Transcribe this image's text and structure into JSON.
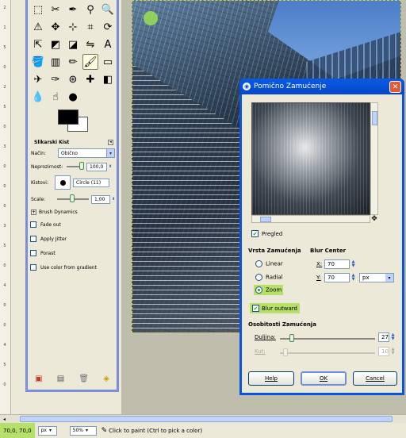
{
  "ruler": {
    "ticks": [
      "2",
      "1",
      "5",
      "0",
      "2",
      "5",
      "0",
      "3",
      "0",
      "0",
      "0",
      "3",
      "5",
      "0",
      "4",
      "0",
      "0",
      "4",
      "5",
      "0"
    ]
  },
  "toolbox": {
    "tools": [
      {
        "icon": "rect-select-icon",
        "glyph": "⬚"
      },
      {
        "icon": "fuzzy-select-icon",
        "glyph": "✂"
      },
      {
        "icon": "paths-icon",
        "glyph": "✒"
      },
      {
        "icon": "color-picker-icon",
        "glyph": "⚲"
      },
      {
        "icon": "zoom-icon",
        "glyph": "🔍"
      },
      {
        "icon": "measure-icon",
        "glyph": "⚠"
      },
      {
        "icon": "move-icon",
        "glyph": "✥"
      },
      {
        "icon": "align-icon",
        "glyph": "⊹"
      },
      {
        "icon": "crop-icon",
        "glyph": "⌗"
      },
      {
        "icon": "rotate-icon",
        "glyph": "⟳"
      },
      {
        "icon": "scale-icon",
        "glyph": "⇱"
      },
      {
        "icon": "shear-icon",
        "glyph": "◩"
      },
      {
        "icon": "perspective-icon",
        "glyph": "◪"
      },
      {
        "icon": "flip-icon",
        "glyph": "⇋"
      },
      {
        "icon": "text-icon",
        "glyph": "A"
      },
      {
        "icon": "bucket-fill-icon",
        "glyph": "🪣"
      },
      {
        "icon": "blend-icon",
        "glyph": "▥"
      },
      {
        "icon": "pencil-icon",
        "glyph": "✏"
      },
      {
        "icon": "paintbrush-icon",
        "glyph": "🖌"
      },
      {
        "icon": "eraser-icon",
        "glyph": "▭"
      },
      {
        "icon": "airbrush-icon",
        "glyph": "✈"
      },
      {
        "icon": "ink-icon",
        "glyph": "✑"
      },
      {
        "icon": "clone-icon",
        "glyph": "⊛"
      },
      {
        "icon": "heal-icon",
        "glyph": "✚"
      },
      {
        "icon": "perspective-clone-icon",
        "glyph": "◧"
      },
      {
        "icon": "blur-icon",
        "glyph": "💧"
      },
      {
        "icon": "smudge-icon",
        "glyph": "☝"
      },
      {
        "icon": "dodge-burn-icon",
        "glyph": "●"
      }
    ],
    "options": {
      "title": "Slikarski Kist",
      "mode_label": "Način:",
      "mode_value": "Obično",
      "opacity_label": "Neprozirnost:",
      "opacity_value": "100,0",
      "opacity_fraction": 1.0,
      "brush_label": "Kistovi:",
      "brush_value": "Circle (11)",
      "scale_label": "Scale:",
      "scale_value": "1,00",
      "dynamics_label": "Brush Dynamics",
      "fade_out": "Fade out",
      "apply_jitter": "Apply Jitter",
      "porast": "Porast",
      "use_gradient": "Use color from gradient"
    },
    "footer_icons": [
      "save-icon",
      "restore-icon",
      "delete-icon",
      "reset-icon"
    ]
  },
  "status": {
    "coords": "70,0, 70,0",
    "unit": "px",
    "zoom": "50%",
    "message": "Click to paint (Ctrl to pick a color)"
  },
  "dialog": {
    "title": "Pomično Zamućenje",
    "preview_label": "Pregled",
    "preview_checked": true,
    "blur_type_label": "Vrsta Zamućenja",
    "blur_types": [
      "Linear",
      "Radial",
      "Zoom"
    ],
    "selected_blur_type": "Zoom",
    "blur_center_label": "Blur Center",
    "x_label": "X:",
    "x_value": "70",
    "y_label": "Y:",
    "y_value": "70",
    "center_unit": "px",
    "blur_outward_label": "Blur outward",
    "blur_outward_checked": true,
    "properties_label": "Osobitosti Zamućenja",
    "length_label": "Duljina:",
    "length_value": "27",
    "angle_label": "Kut:",
    "angle_value": "10",
    "help_button": "Help",
    "ok_button": "OK",
    "cancel_button": "Cancel"
  }
}
